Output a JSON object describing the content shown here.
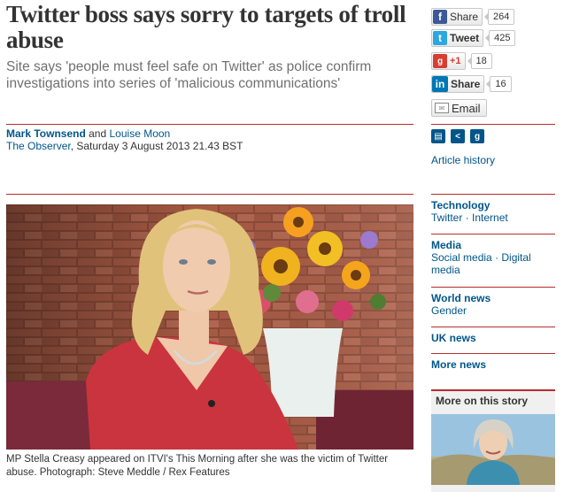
{
  "article": {
    "headline": "Twitter boss says sorry to targets of troll abuse",
    "standfirst": "Site says 'people must feel safe on Twitter' as police confirm investigations into series of 'malicious communications'",
    "author1": "Mark Townsend",
    "and": " and ",
    "author2": "Louise Moon",
    "publication": "The Observer",
    "date": ", Saturday 3 August 2013 21.43 BST",
    "caption": "MP Stella Creasy appeared on ITVI's This Morning after she was the victim of Twitter abuse. Photograph: Steve Meddle / Rex Features"
  },
  "share": {
    "facebook": {
      "label": "Share",
      "count": "264",
      "icon": "facebook-icon"
    },
    "twitter": {
      "label": "Tweet",
      "count": "425",
      "icon": "twitter-icon"
    },
    "gplus": {
      "label": "+1",
      "count": "18",
      "icon": "google-plus-icon"
    },
    "linkedin": {
      "label": "Share",
      "count": "16",
      "icon": "linkedin-icon"
    },
    "email": {
      "label": "Email",
      "icon": "email-icon"
    }
  },
  "tools": {
    "icons": [
      "print-icon",
      "share-icon",
      "guardian-icon"
    ],
    "article_history": "Article history"
  },
  "sections": {
    "technology": {
      "heading": "Technology",
      "items": "Twitter · Internet"
    },
    "media": {
      "heading": "Media",
      "items": "Social media · Digital media"
    },
    "world": {
      "heading": "World news",
      "items": "Gender"
    },
    "uk": {
      "heading": "UK news"
    },
    "more": {
      "heading": "More news"
    }
  },
  "more_on_story": {
    "title": "More on this story"
  },
  "colors": {
    "accent_rule": "#b72d2d",
    "link": "#005689",
    "facebook": "#3b5998",
    "twitter": "#2ca7e0",
    "gplus": "#d73d32",
    "linkedin": "#0077b5"
  }
}
